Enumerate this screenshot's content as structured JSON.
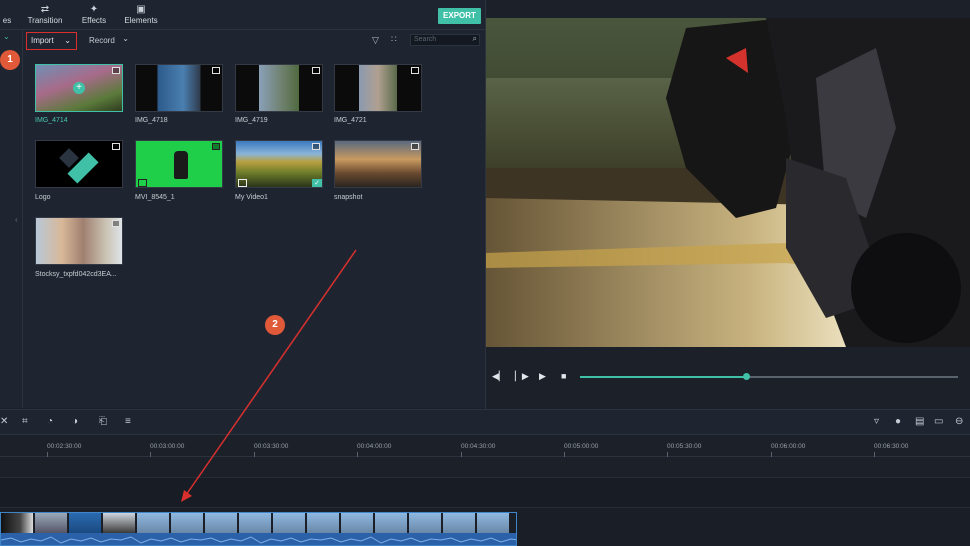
{
  "top_tabs": [
    {
      "icon": "media-icon",
      "label": "es"
    },
    {
      "icon": "transition-icon",
      "label": "Transition"
    },
    {
      "icon": "effects-icon",
      "label": "Effects"
    },
    {
      "icon": "elements-icon",
      "label": "Elements"
    }
  ],
  "export_label": "EXPORT",
  "toolbar": {
    "import_label": "Import",
    "record_label": "Record",
    "search_placeholder": "Search"
  },
  "badges": {
    "one": "1",
    "two": "2"
  },
  "media_items": [
    {
      "label": "IMG_4714",
      "selected": true
    },
    {
      "label": "IMG_4718",
      "selected": false
    },
    {
      "label": "IMG_4719",
      "selected": false
    },
    {
      "label": "IMG_4721",
      "selected": false
    },
    {
      "label": "Logo",
      "selected": false
    },
    {
      "label": "MVI_8545_1",
      "selected": false
    },
    {
      "label": "My Video1",
      "selected": false
    },
    {
      "label": "snapshot",
      "selected": false
    },
    {
      "label": "Stocksy_txpfd042cd3EA...",
      "selected": false
    }
  ],
  "player": {
    "progress": 0.44
  },
  "timeline": {
    "ruler_labels": [
      "00:02:30:00",
      "00:03:00:00",
      "00:03:30:00",
      "00:04:00:00",
      "00:04:30:00",
      "00:05:00:00",
      "00:05:30:00",
      "00:06:00:00",
      "00:06:30:00"
    ]
  },
  "colors": {
    "accent": "#41c0a8",
    "highlight": "#d9302e",
    "badge": "#e05a3a",
    "clip_border": "#3f86c8"
  }
}
